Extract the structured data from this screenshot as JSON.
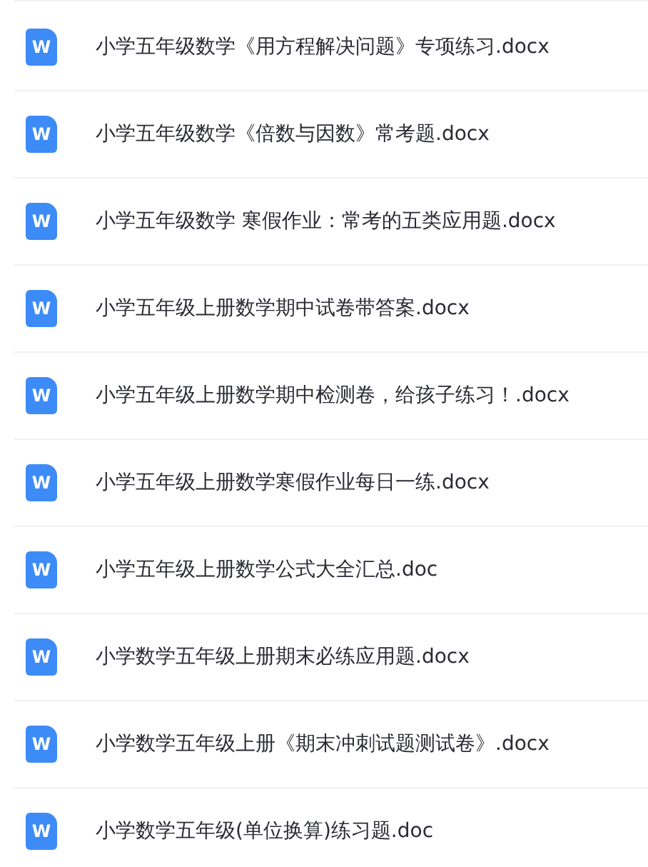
{
  "files": [
    {
      "icon": "W",
      "name": "小学五年级数学《用方程解决问题》专项练习.docx"
    },
    {
      "icon": "W",
      "name": "小学五年级数学《倍数与因数》常考题.docx"
    },
    {
      "icon": "W",
      "name": "小学五年级数学 寒假作业：常考的五类应用题.docx"
    },
    {
      "icon": "W",
      "name": "小学五年级上册数学期中试卷带答案.docx"
    },
    {
      "icon": "W",
      "name": "小学五年级上册数学期中检测卷，给孩子练习！.docx"
    },
    {
      "icon": "W",
      "name": "小学五年级上册数学寒假作业每日一练.docx"
    },
    {
      "icon": "W",
      "name": "小学五年级上册数学公式大全汇总.doc"
    },
    {
      "icon": "W",
      "name": "小学数学五年级上册期末必练应用题.docx"
    },
    {
      "icon": "W",
      "name": "小学数学五年级上册《期末冲刺试题测试卷》.docx"
    },
    {
      "icon": "W",
      "name": "小学数学五年级(单位换算)练习题.doc"
    }
  ]
}
